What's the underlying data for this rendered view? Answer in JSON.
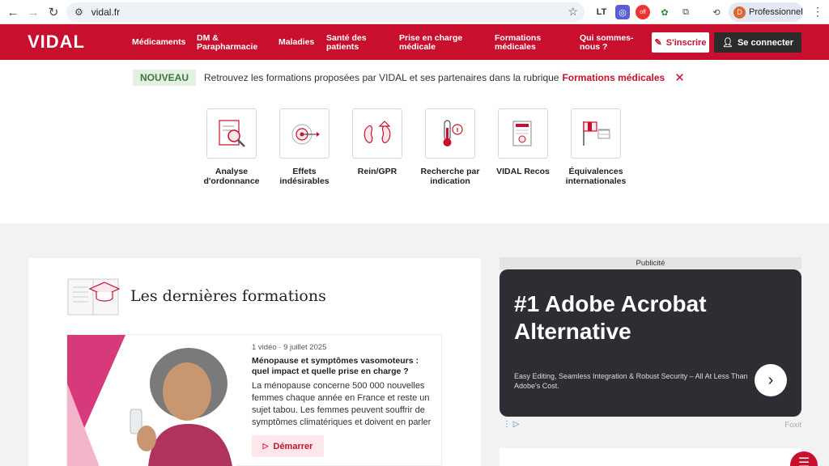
{
  "browser": {
    "url": "vidal.fr",
    "profile_name": "Professionnel",
    "profile_initial": "D",
    "extensions": [
      "LT",
      "off"
    ]
  },
  "header": {
    "logo": "VIDAL",
    "menu": [
      {
        "label": "Médicaments"
      },
      {
        "label": "DM & Parapharmacie"
      },
      {
        "label": "Maladies"
      },
      {
        "label": "Santé des patients"
      },
      {
        "label": "Prise en charge médicale"
      },
      {
        "label": "Formations médicales"
      },
      {
        "label": "Qui sommes-nous ?"
      }
    ],
    "signup_label": "S'inscrire",
    "login_label": "Se connecter"
  },
  "banner": {
    "badge": "NOUVEAU",
    "text": "Retrouvez les formations proposées par VIDAL et ses partenaires dans la rubrique",
    "link": "Formations médicales"
  },
  "tools": [
    {
      "label": "Analyse d'ordonnance"
    },
    {
      "label": "Effets indésirables"
    },
    {
      "label": "Rein/GPR"
    },
    {
      "label": "Recherche par indication"
    },
    {
      "label": "VIDAL Recos"
    },
    {
      "label": "Équivalences internationales"
    }
  ],
  "formations": {
    "title": "Les dernières formations",
    "article": {
      "meta": "1 vidéo · 9 juillet 2025",
      "title": "Ménopause et symptômes vasomoteurs : quel impact et quelle prise en charge ?",
      "description": "La ménopause concerne 500 000 nouvelles femmes chaque année en France et reste un sujet tabou. Les femmes peuvent souffrir de symptômes climatériques et doivent en parler ...",
      "button": "Démarrer"
    }
  },
  "ad": {
    "label": "Publicité",
    "title": "#1 Adobe Acrobat Alternative",
    "subtitle": "Easy Editing, Seamless Integration & Robust Security – All At Less Than Adobe's Cost.",
    "sponsor": "Foxit"
  },
  "colors": {
    "brand": "#c8102e",
    "dark": "#2b2b2b",
    "new_badge_bg": "#e3f0e3"
  }
}
